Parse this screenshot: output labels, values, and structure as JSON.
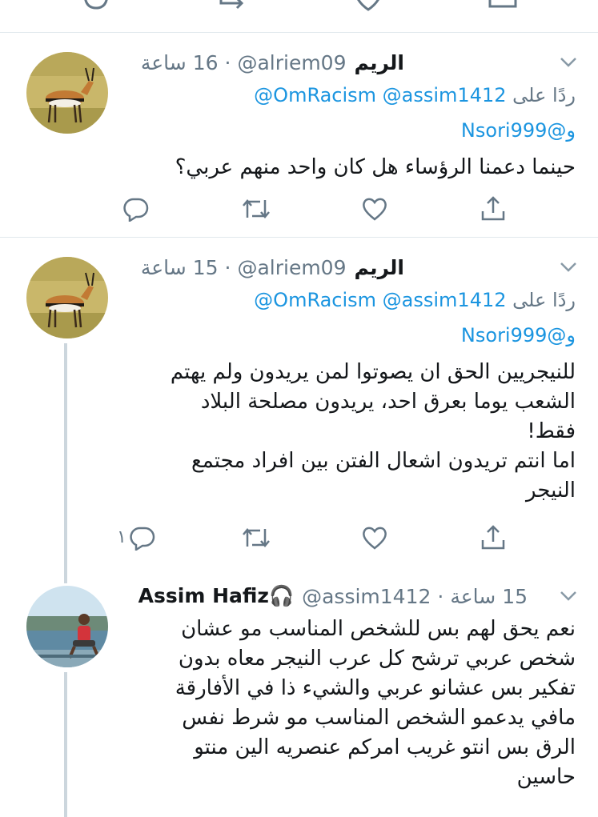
{
  "tweets": [
    {
      "name": "الريم",
      "handle": "@alriem09",
      "time": "16 ساعة",
      "reply_prefix": "ردًا على",
      "reply_handles_line1": "@OmRacism @assim1412",
      "reply_handles_line2": "و@Nsori999",
      "text": "حينما دعمنا الرؤساء هل كان واحد منهم عربي؟",
      "reply_count": ""
    },
    {
      "name": "الريم",
      "handle": "@alriem09",
      "time": "15 ساعة",
      "reply_prefix": "ردًا على",
      "reply_handles_line1": "@OmRacism @assim1412",
      "reply_handles_line2": "و@Nsori999",
      "text": "للنيجريين الحق ان يصوتوا لمن يريدون ولم يهتم\nالشعب يوما بعرق احد،  يريدون مصلحة البلاد\nفقط!\nاما انتم تريدون اشعال الفتن بين افراد مجتمع\nالنيجر",
      "reply_count": "١"
    },
    {
      "name": "Assim Hafiz🎧",
      "handle": "@assim1412",
      "time": "15 ساعة",
      "text": "نعم يحق لهم بس للشخص المناسب مو عشان\nشخص عربي ترشح كل عرب النيجر معاه بدون\nتفكير بس عشانو عربي والشيء ذا في الأفارقة\nمافي يدعمو الشخص المناسب مو شرط نفس\nالرق بس انتو غريب امركم عنصريه الين منتو\nحاسين"
    }
  ],
  "dot": "·",
  "colors": {
    "link": "#1b95e0",
    "meta": "#657786",
    "divider": "#e1e8ed",
    "thread": "#ccd6dd"
  }
}
